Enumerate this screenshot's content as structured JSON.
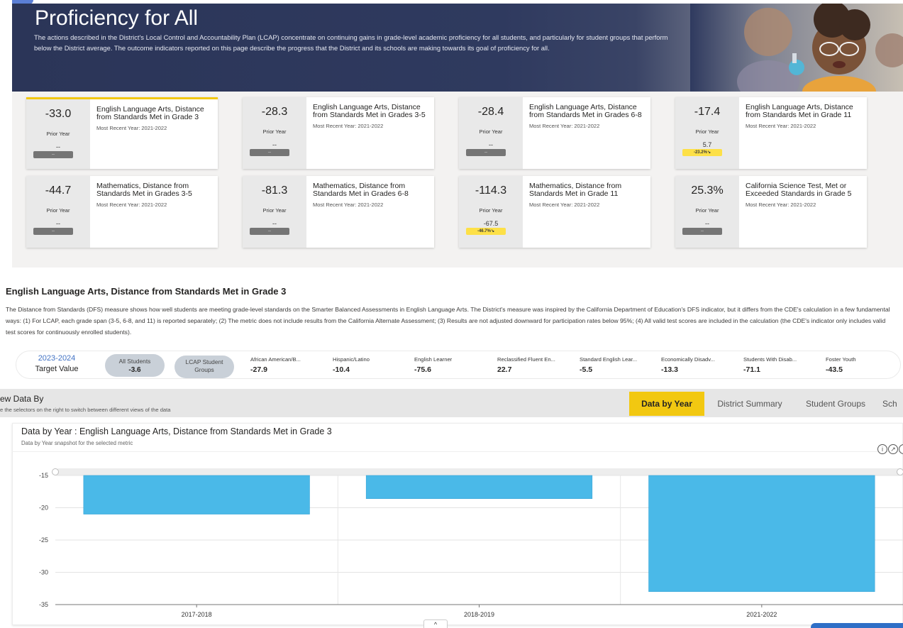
{
  "banner": {
    "title": "Proficiency for All",
    "description": "The actions described in the District's Local Control and Accountability Plan (LCAP) concentrate on continuing gains in grade-level academic proficiency for all students, and particularly for student groups that perform below the District average. The outcome indicators reported on this page describe the progress that the District and its schools are making towards its goal of proficiency for all."
  },
  "cards": [
    {
      "value": "-33.0",
      "prior_label": "Prior Year",
      "prior_value": "--",
      "change": "--",
      "change_highlight": false,
      "name": "English Language Arts, Distance from Standards Met in Grade 3",
      "recent": "Most Recent Year: 2021-2022",
      "active": true
    },
    {
      "value": "-28.3",
      "prior_label": "Prior Year",
      "prior_value": "--",
      "change": "--",
      "change_highlight": false,
      "name": "English Language Arts, Distance from Standards Met in Grades 3-5",
      "recent": "Most Recent Year: 2021-2022",
      "active": false
    },
    {
      "value": "-28.4",
      "prior_label": "Prior Year",
      "prior_value": "--",
      "change": "--",
      "change_highlight": false,
      "name": "English Language Arts, Distance from Standards Met in Grades 6-8",
      "recent": "Most Recent Year: 2021-2022",
      "active": false
    },
    {
      "value": "-17.4",
      "prior_label": "Prior Year",
      "prior_value": "5.7",
      "change": "-23.2%↘",
      "change_highlight": true,
      "name": "English Language Arts, Distance from Standards Met in Grade 11",
      "recent": "Most Recent Year: 2021-2022",
      "active": false
    },
    {
      "value": "-44.7",
      "prior_label": "Prior Year",
      "prior_value": "--",
      "change": "--",
      "change_highlight": false,
      "name": "Mathematics, Distance from Standards Met in Grades 3-5",
      "recent": "Most Recent Year: 2021-2022",
      "active": false
    },
    {
      "value": "-81.3",
      "prior_label": "Prior Year",
      "prior_value": "--",
      "change": "--",
      "change_highlight": false,
      "name": "Mathematics, Distance from Standards Met in Grades 6-8",
      "recent": "Most Recent Year: 2021-2022",
      "active": false
    },
    {
      "value": "-114.3",
      "prior_label": "Prior Year",
      "prior_value": "-67.5",
      "change": "-46.7%↘",
      "change_highlight": true,
      "name": "Mathematics, Distance from Standards Met in Grade 11",
      "recent": "Most Recent Year: 2021-2022",
      "active": false
    },
    {
      "value": "25.3%",
      "prior_label": "Prior Year",
      "prior_value": "--",
      "change": "--",
      "change_highlight": false,
      "name": "California Science Test, Met or Exceeded Standards in Grade 5",
      "recent": "Most Recent Year: 2021-2022",
      "active": false
    }
  ],
  "section": {
    "title": "English Language Arts, Distance from Standards Met in Grade 3",
    "description": "The Distance from Standards (DFS) measure shows how well students are meeting grade-level standards on the Smarter Balanced Assessments in English Language Arts. The District's measure was inspired by the California Department of Education's DFS indicator, but it differs from the CDE's calculation in a few fundamental ways: (1) For LCAP, each grade span (3-5, 6-8, and 11) is reported separately; (2) The metric does not include results from the California Alternate Assessment; (3) Results are not adjusted downward for participation rates below 95%; (4) All valid test scores are included in the calculation (the CDE's indicator only includes valid test scores for continuously enrolled students)."
  },
  "target": {
    "year": "2023-2024",
    "label": "Target Value",
    "all_students_label": "All Students",
    "all_students_value": "-3.6",
    "lcap_label": "LCAP Student Groups",
    "groups": [
      {
        "name": "African American/B...",
        "value": "-27.9"
      },
      {
        "name": "Hispanic/Latino",
        "value": "-10.4"
      },
      {
        "name": "English Learner",
        "value": "-75.6"
      },
      {
        "name": "Reclassified Fluent En...",
        "value": "22.7"
      },
      {
        "name": "Standard English Lear...",
        "value": "-5.5"
      },
      {
        "name": "Economically Disadv...",
        "value": "-13.3"
      },
      {
        "name": "Students With Disab...",
        "value": "-71.1"
      },
      {
        "name": "Foster Youth",
        "value": "-43.5"
      }
    ]
  },
  "view": {
    "title": "ew Data By",
    "subtitle": "e the selectors on the right to switch between different views of the data",
    "tabs": [
      "Data by Year",
      "District Summary",
      "Student Groups",
      "Sch"
    ],
    "active_tab": "Data by Year"
  },
  "chart_panel": {
    "title": "Data by Year : English Language Arts, Distance from Standards Met in Grade 3",
    "subtitle": "Data by Year snapshot for the selected metric",
    "icons": [
      "info-icon",
      "expand-icon",
      "more-icon"
    ]
  },
  "chart_data": {
    "type": "bar",
    "categories": [
      "2017-2018",
      "2018-2019",
      "2021-2022"
    ],
    "values": [
      -21,
      -18.6,
      -33
    ],
    "ylim": [
      -35,
      -15
    ],
    "yticks": [
      -15,
      -20,
      -25,
      -30,
      -35
    ],
    "bar_color": "#4ab9e8",
    "grid": true,
    "title": "",
    "xlabel": "",
    "ylabel": ""
  },
  "colors": {
    "accent": "#f2c811",
    "banner": "#2b3558",
    "bar": "#4ab9e8",
    "link": "#4172c4",
    "change_highlight": "#fde047"
  }
}
